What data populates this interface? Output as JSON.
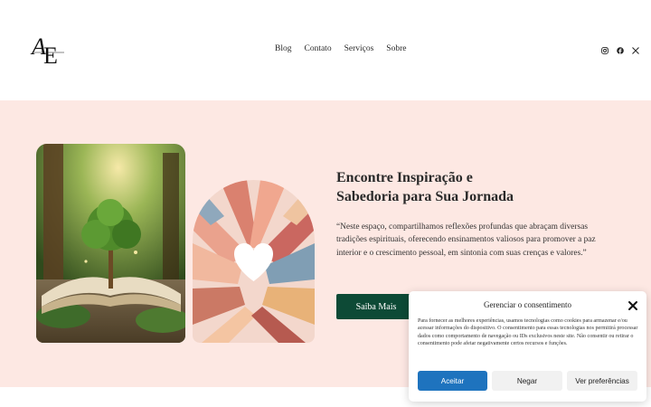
{
  "header": {
    "logo_text": "AE",
    "nav": [
      "Blog",
      "Contato",
      "Serviços",
      "Sobre"
    ],
    "socials": [
      "instagram-icon",
      "facebook-icon",
      "x-icon"
    ]
  },
  "hero": {
    "title_line1": "Encontre Inspiração e",
    "title_line2": "Sabedoria para Sua Jornada",
    "quote": "“Neste espaço, compartilhamos reflexões profundas que abraçam diversas tradições espirituais, oferecendo ensinamentos valiosos para promover a paz interior e o crescimento pessoal, em sintonia com suas crenças e valores.”",
    "cta_label": "Saiba Mais",
    "colors": {
      "background": "#fde8e3",
      "cta": "#0d4a36"
    }
  },
  "consent": {
    "title": "Gerenciar o consentimento",
    "text": "Para fornecer as melhores experiências, usamos tecnologias como cookies para armazenar e/ou acessar informações do dispositivo. O consentimento para essas tecnologias nos permitirá processar dados como comportamento de navegação ou IDs exclusivos neste site. Não consentir ou retirar o consentimento pode afetar negativamente certos recursos e funções.",
    "accept_label": "Aceitar",
    "deny_label": "Negar",
    "prefs_label": "Ver preferências",
    "accent": "#1e73be"
  }
}
